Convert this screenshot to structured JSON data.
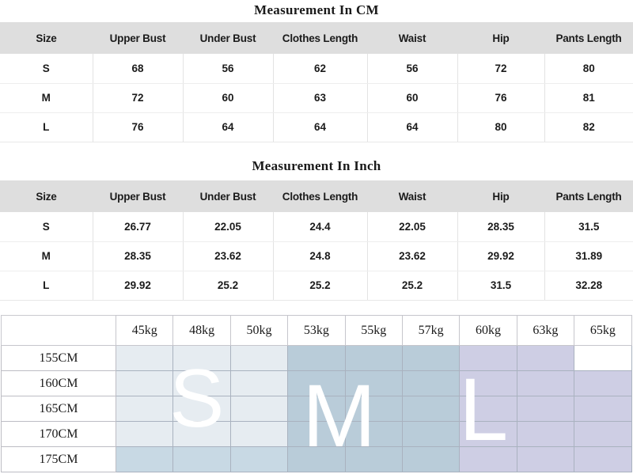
{
  "colors": {
    "header_bg": "#dedede",
    "grid_border": "#a9b2bf",
    "size_s_fill": "#e6ecf1",
    "size_s_dark_fill": "#c8d9e4",
    "size_m_fill": "#b9ccd9",
    "size_l_fill": "#cecee4",
    "empty_fill": "#ffffff",
    "text": "#1b1b1b"
  },
  "cm_table": {
    "title": "Measurement In CM",
    "columns": [
      "Size",
      "Upper Bust",
      "Under Bust",
      "Clothes Length",
      "Waist",
      "Hip",
      "Pants Length"
    ],
    "rows": [
      [
        "S",
        "68",
        "56",
        "62",
        "56",
        "72",
        "80"
      ],
      [
        "M",
        "72",
        "60",
        "63",
        "60",
        "76",
        "81"
      ],
      [
        "L",
        "76",
        "64",
        "64",
        "64",
        "80",
        "82"
      ]
    ]
  },
  "inch_table": {
    "title": "Measurement In Inch",
    "columns": [
      "Size",
      "Upper Bust",
      "Under Bust",
      "Clothes Length",
      "Waist",
      "Hip",
      "Pants Length"
    ],
    "rows": [
      [
        "S",
        "26.77",
        "22.05",
        "24.4",
        "22.05",
        "28.35",
        "31.5"
      ],
      [
        "M",
        "28.35",
        "23.62",
        "24.8",
        "23.62",
        "29.92",
        "31.89"
      ],
      [
        "L",
        "29.92",
        "25.2",
        "25.2",
        "25.2",
        "31.5",
        "32.28"
      ]
    ]
  },
  "size_matrix": {
    "corner_label": "",
    "weights": [
      "45kg",
      "48kg",
      "50kg",
      "53kg",
      "55kg",
      "57kg",
      "60kg",
      "63kg",
      "65kg"
    ],
    "heights": [
      "155CM",
      "160CM",
      "165CM",
      "170CM",
      "175CM"
    ],
    "watermarks": [
      "S",
      "M",
      "L"
    ],
    "cells": [
      [
        "s",
        "s",
        "s",
        "m",
        "m",
        "m",
        "l",
        "l",
        "none"
      ],
      [
        "s",
        "s",
        "s",
        "m",
        "m",
        "m",
        "l",
        "l",
        "l"
      ],
      [
        "s",
        "s",
        "s",
        "m",
        "m",
        "m",
        "l",
        "l",
        "l"
      ],
      [
        "s",
        "s",
        "s",
        "m",
        "m",
        "m",
        "l",
        "l",
        "l"
      ],
      [
        "s2",
        "s2",
        "s2",
        "m",
        "m",
        "m",
        "l",
        "l",
        "l"
      ]
    ]
  }
}
